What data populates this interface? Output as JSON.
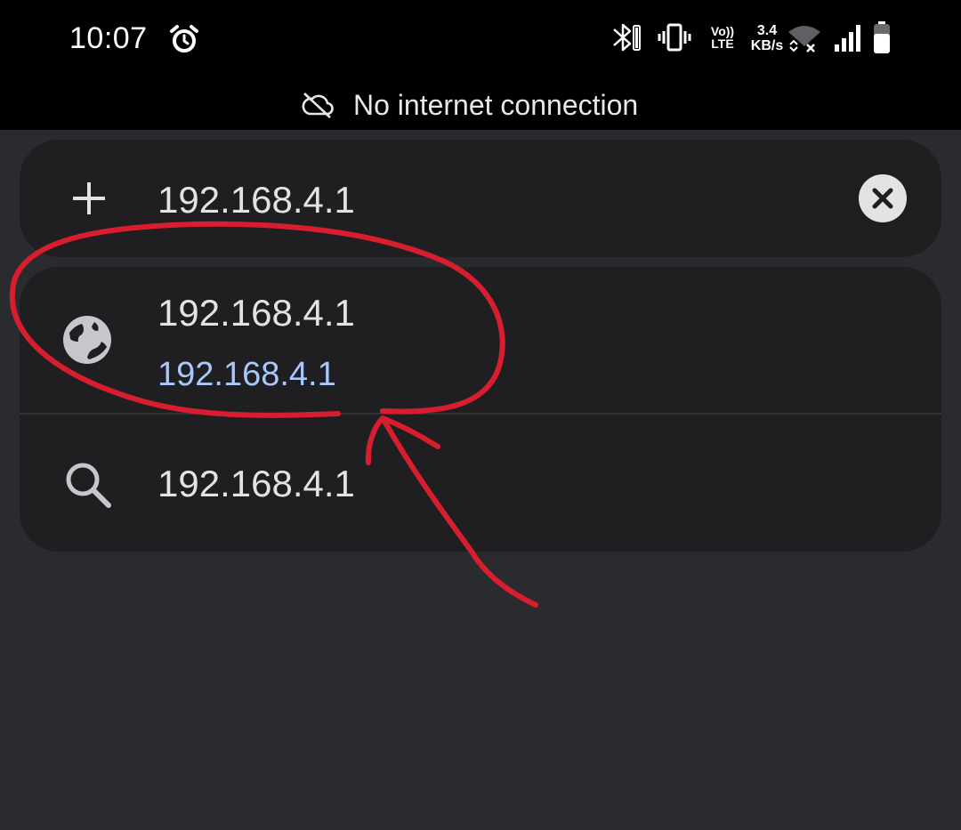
{
  "status_bar": {
    "time": "10:07",
    "net_speed_value": "3.4",
    "net_speed_unit": "KB/s",
    "volte_top": "Vo))",
    "volte_bottom": "LTE",
    "icons": [
      "alarm-icon",
      "bluetooth-icon",
      "vibrate-icon",
      "volte-icon",
      "wifi-off-icon",
      "signal-icon",
      "battery-icon"
    ]
  },
  "banner": {
    "icon": "cloud-off-icon",
    "text": "No internet connection"
  },
  "omnibox": {
    "value": "192.168.4.1",
    "leading_icon": "plus-icon",
    "trailing_icon": "clear-icon"
  },
  "suggestions": [
    {
      "type": "url",
      "icon": "globe-icon",
      "title": "192.168.4.1",
      "url": "192.168.4.1"
    },
    {
      "type": "search",
      "icon": "search-icon",
      "query": "192.168.4.1"
    }
  ],
  "colors": {
    "background": "#2a2b2f",
    "card": "#1f1f22",
    "text": "#e3e3e6",
    "link": "#a8c7fa",
    "annotation": "#d81e2e"
  }
}
